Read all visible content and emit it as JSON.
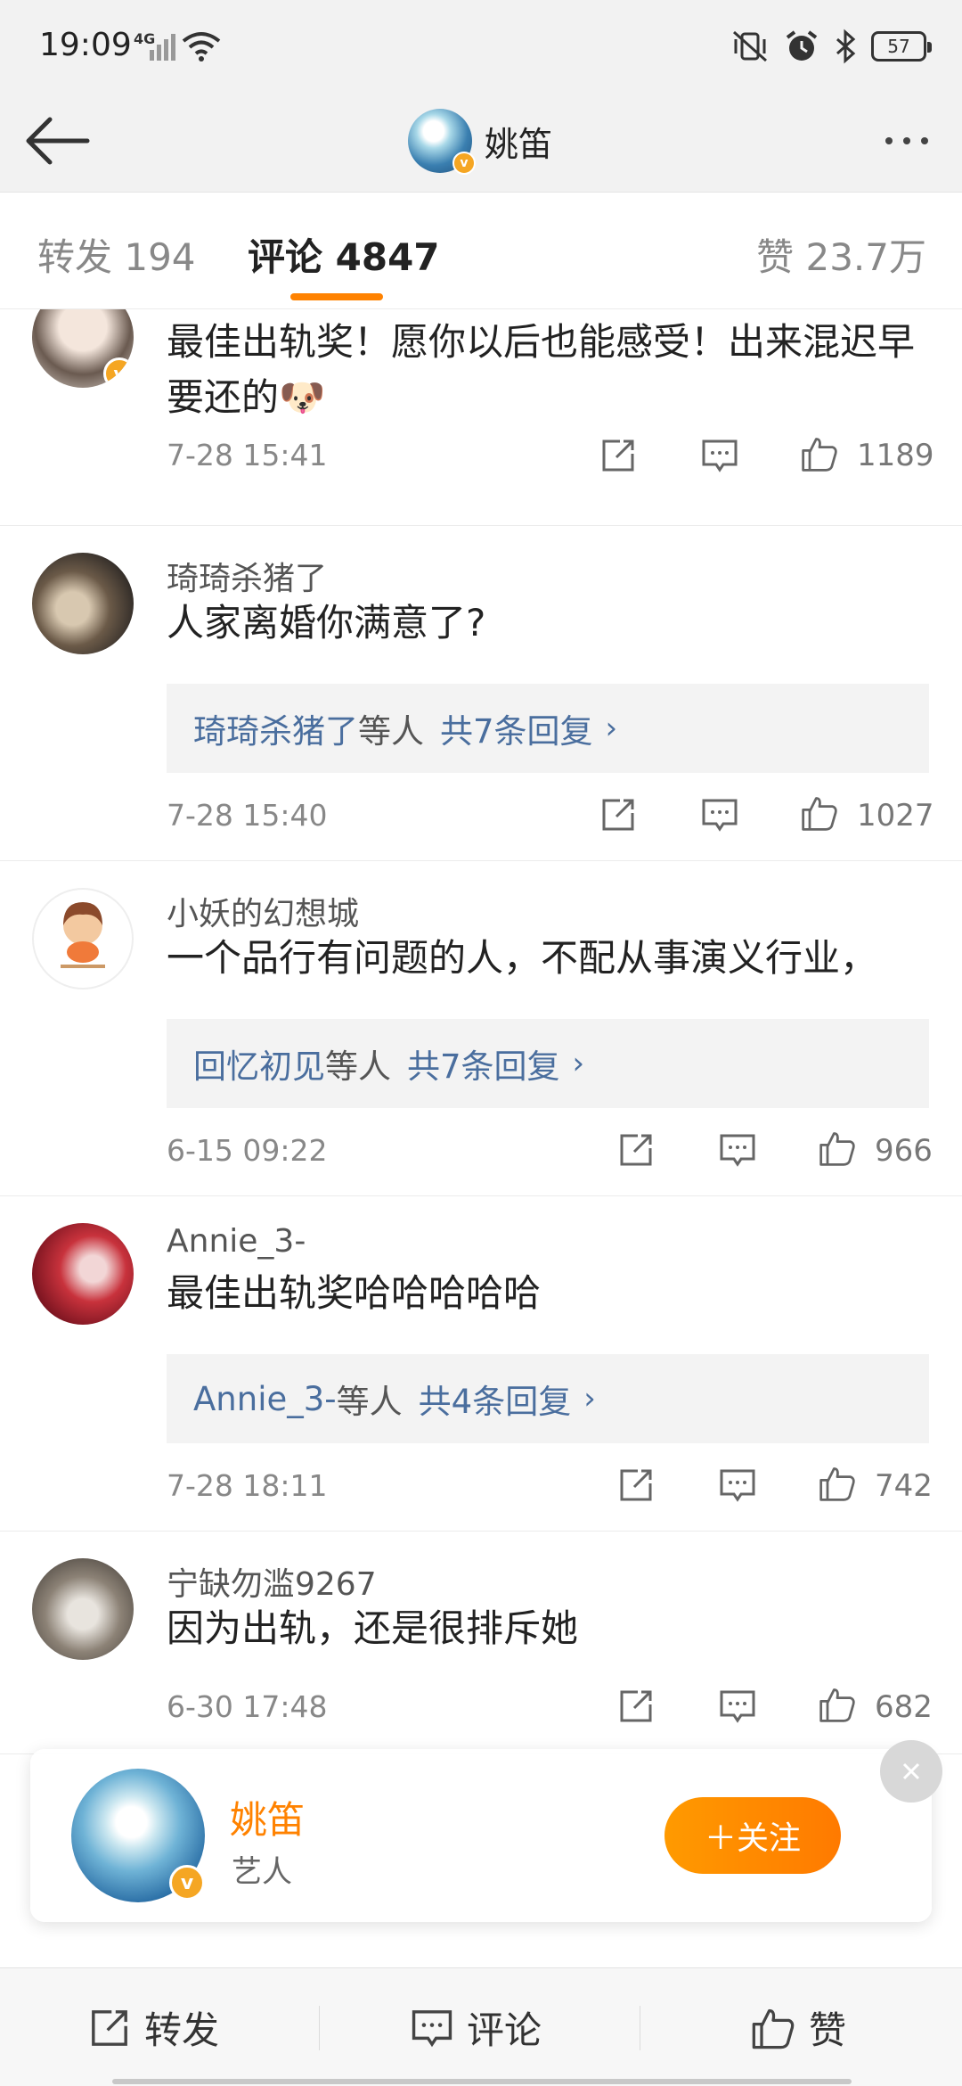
{
  "status_bar": {
    "time": "19:09",
    "network": "4G",
    "battery": "57"
  },
  "header": {
    "title": "姚笛"
  },
  "tabs": {
    "repost": "转发 194",
    "comments": "评论 4847",
    "likes": "赞 23.7万"
  },
  "comments": [
    {
      "name": "",
      "text": "最佳出轨奖！愿你以后也能感受！出来混迟早要还的🐶",
      "time": "7-28 15:41",
      "likes": "1189",
      "verified": true
    },
    {
      "name": "琦琦杀猪了",
      "text": "人家离婚你满意了?",
      "reply": {
        "users": "琦琦杀猪了",
        "mid": "等人",
        "count": "共7条回复"
      },
      "time": "7-28 15:40",
      "likes": "1027"
    },
    {
      "name": "小妖的幻想城",
      "text": "一个品行有问题的人，不配从事演义行业，",
      "reply": {
        "users": "回忆初见",
        "mid": "等人",
        "count": "共7条回复"
      },
      "time": "6-15 09:22",
      "likes": "966"
    },
    {
      "name": "Annie_3-",
      "text": "最佳出轨奖哈哈哈哈哈",
      "reply": {
        "users": "Annie_3-",
        "mid": "等人",
        "count": "共4条回复"
      },
      "time": "7-28 18:11",
      "likes": "742"
    },
    {
      "name": "宁缺勿滥9267",
      "text": "因为出轨，还是很排斥她",
      "time": "6-30 17:48",
      "likes": "682"
    }
  ],
  "follow_card": {
    "name": "姚笛",
    "role": "艺人",
    "button": "＋关注"
  },
  "bottom_bar": {
    "repost": "转发",
    "comment": "评论",
    "like": "赞"
  },
  "colors": {
    "accent": "#ff8200",
    "link": "#4a6e9e",
    "verified": "#f5a623"
  }
}
